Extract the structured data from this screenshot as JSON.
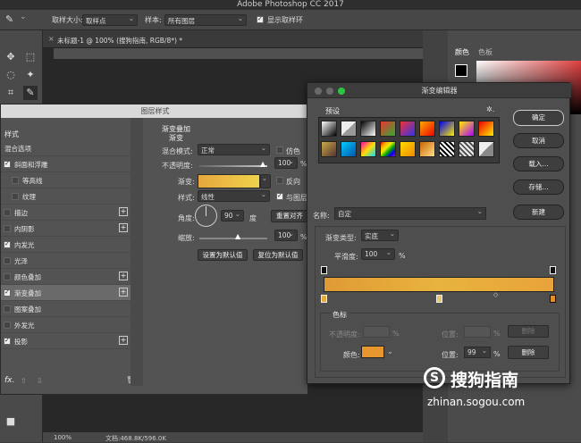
{
  "app": {
    "title": "Adobe Photoshop CC 2017"
  },
  "options": {
    "sample_size_label": "取样大小:",
    "sample_size_value": "取样点",
    "sample_label": "样本:",
    "sample_value": "所有图层",
    "show_ring_label": "显示取样环"
  },
  "document": {
    "tab_title": "未标题-1 @ 100% (搜狗指南, RGB/8*) *",
    "zoom": "100%",
    "doc_size": "文档:468.8K/596.0K"
  },
  "panels": {
    "color_tab": "颜色",
    "swatches_tab": "色板"
  },
  "layer_style": {
    "title": "图层样式",
    "style_header": "样式",
    "items": [
      {
        "label": "混合选项",
        "checkbox": false,
        "plus": false,
        "checked": false
      },
      {
        "label": "斜面和浮雕",
        "checkbox": true,
        "plus": false,
        "checked": true
      },
      {
        "label": "等高线",
        "checkbox": true,
        "plus": false,
        "checked": false,
        "indent": true
      },
      {
        "label": "纹理",
        "checkbox": true,
        "plus": false,
        "checked": false,
        "indent": true
      },
      {
        "label": "描边",
        "checkbox": true,
        "plus": true,
        "checked": false
      },
      {
        "label": "内阴影",
        "checkbox": true,
        "plus": true,
        "checked": false
      },
      {
        "label": "内发光",
        "checkbox": true,
        "plus": false,
        "checked": true
      },
      {
        "label": "光泽",
        "checkbox": true,
        "plus": false,
        "checked": false
      },
      {
        "label": "颜色叠加",
        "checkbox": true,
        "plus": true,
        "checked": false
      },
      {
        "label": "渐变叠加",
        "checkbox": true,
        "plus": true,
        "checked": true,
        "selected": true
      },
      {
        "label": "图案叠加",
        "checkbox": true,
        "plus": false,
        "checked": false
      },
      {
        "label": "外发光",
        "checkbox": true,
        "plus": false,
        "checked": false
      },
      {
        "label": "投影",
        "checkbox": true,
        "plus": true,
        "checked": true
      }
    ],
    "fx_label": "fx.",
    "section_title": "渐变叠加",
    "section_sub": "渐变",
    "blend_mode_label": "混合模式:",
    "blend_mode_value": "正常",
    "dither_label": "仿色",
    "opacity_label": "不透明度:",
    "opacity_value": "100",
    "percent": "%",
    "gradient_label": "渐变:",
    "reverse_label": "反向",
    "style_label": "样式:",
    "style_value": "线性",
    "align_label": "与图层",
    "angle_label": "角度:",
    "angle_value": "90",
    "degree": "度",
    "reset_align": "重置对齐",
    "scale_label": "缩放:",
    "scale_value": "100",
    "set_default": "设置为默认值",
    "reset_default": "复位为默认值"
  },
  "gradient_editor": {
    "title": "渐变编辑器",
    "presets_label": "预设",
    "gear": "✲.",
    "ok": "确定",
    "cancel": "取消",
    "load": "载入...",
    "save": "存储...",
    "new": "新建",
    "name_label": "名称:",
    "name_value": "自定",
    "type_label": "渐变类型:",
    "type_value": "实底",
    "smooth_label": "平滑度:",
    "smooth_value": "100",
    "percent": "%",
    "stops_label": "色标",
    "opacity_label": "不透明度:",
    "location_label": "位置:",
    "delete_label": "删除",
    "color_label": "颜色:",
    "location_value": "99",
    "stop_color": "#e8962e"
  },
  "watermark": {
    "brand": "搜狗指南",
    "url": "zhinan.sogou.com"
  }
}
